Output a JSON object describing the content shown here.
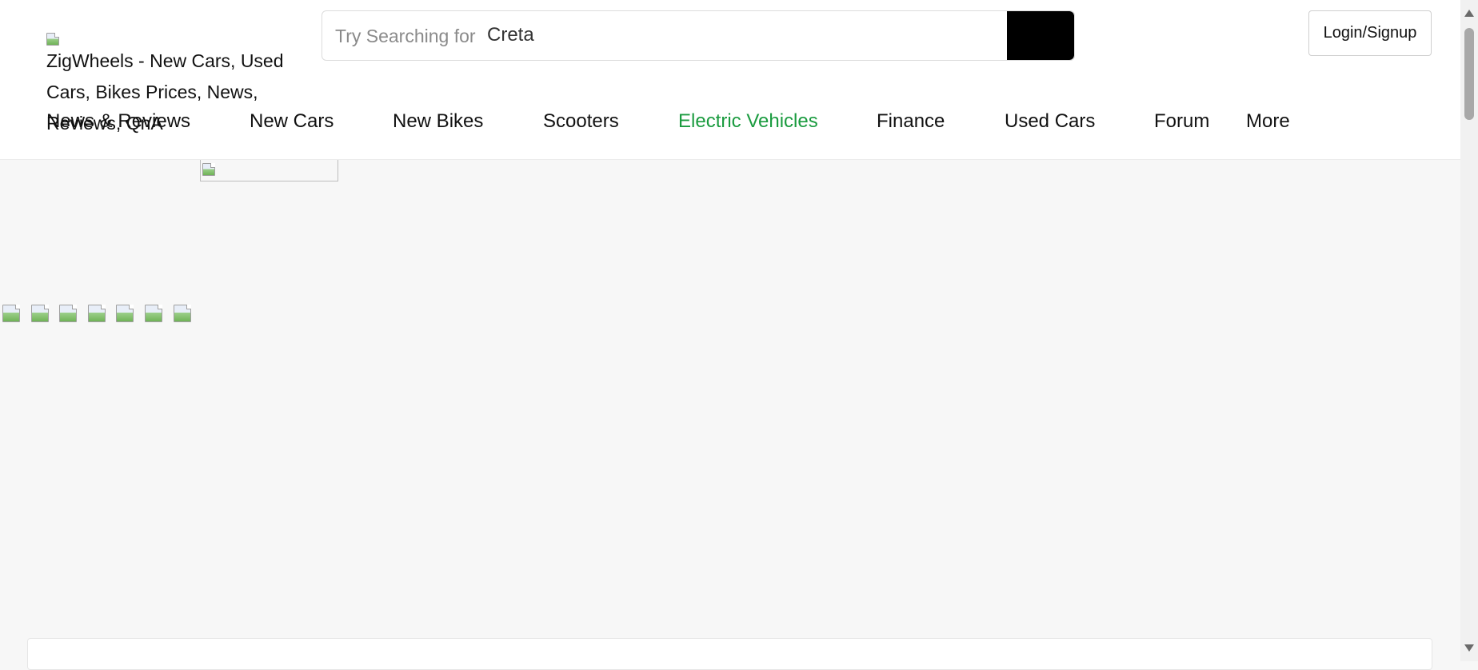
{
  "header": {
    "logo_alt": "ZigWheels - New Cars, Used Cars, Bikes Prices, News, Reviews, QnA",
    "logo_icon": "broken-image-icon",
    "login_label": "Login/Signup"
  },
  "search": {
    "prefix": "Try Searching for",
    "value": "Creta",
    "button_icon": "search-icon"
  },
  "nav": {
    "items": [
      {
        "label": "News & Reviews"
      },
      {
        "label": "New Cars"
      },
      {
        "label": "New Bikes"
      },
      {
        "label": "Scooters"
      },
      {
        "label": "Electric Vehicles"
      },
      {
        "label": "Finance"
      },
      {
        "label": "Used Cars"
      },
      {
        "label": "Forum"
      },
      {
        "label": "More"
      }
    ],
    "active_color": "#1a9b3f"
  },
  "colors": {
    "background": "#f7f7f7",
    "header": "#ffffff",
    "search_button": "#000000"
  }
}
